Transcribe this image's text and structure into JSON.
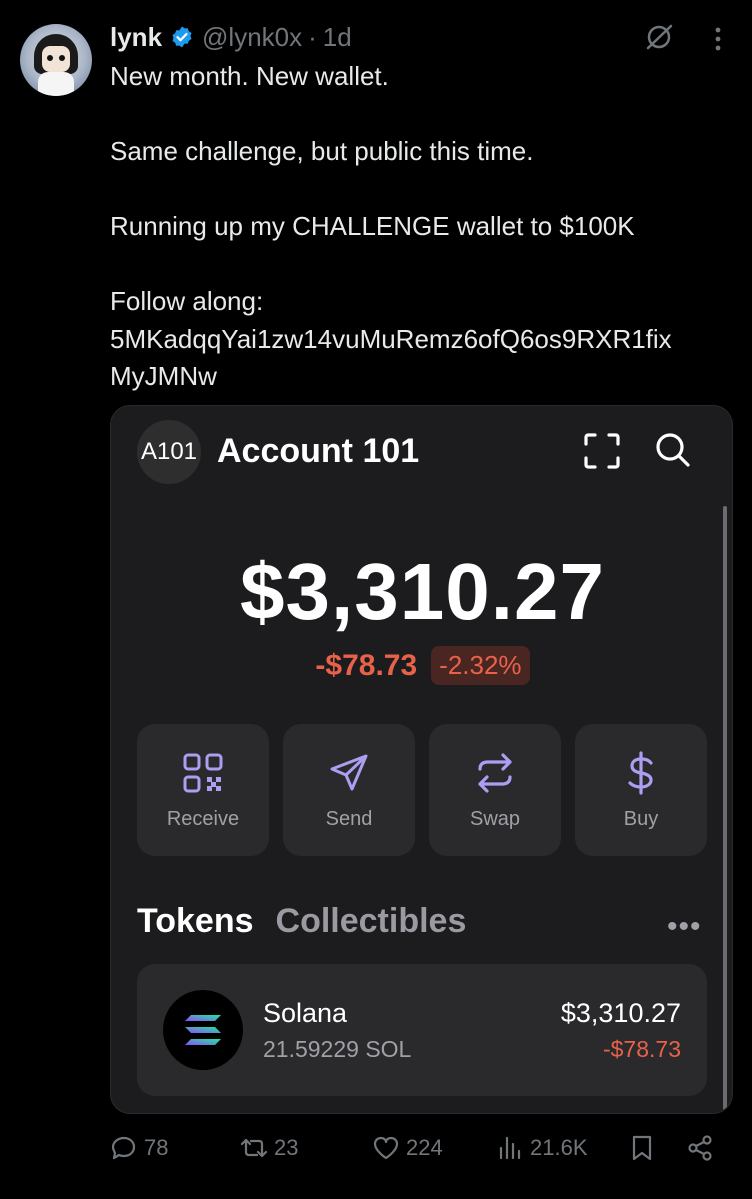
{
  "tweet": {
    "author_name": "lynk",
    "handle": "@lynk0x",
    "time": "1d",
    "text_lines": [
      "New month. New wallet.",
      "Same challenge, but public this time.",
      "Running up my CHALLENGE wallet to $100K",
      "Follow along:\n5MKadqqYai1zw14vuMuRemz6ofQ6os9RXR1fix\nMyJMNw"
    ],
    "icons": [
      "verified-badge-icon",
      "grok-icon",
      "more-icon"
    ]
  },
  "wallet": {
    "account_badge": "A101",
    "account_name": "Account 101",
    "balance": "$3,310.27",
    "change_usd": "-$78.73",
    "change_pct": "-2.32%",
    "actions": [
      {
        "label": "Receive",
        "icon": "qr-icon"
      },
      {
        "label": "Send",
        "icon": "send-icon"
      },
      {
        "label": "Swap",
        "icon": "swap-icon"
      },
      {
        "label": "Buy",
        "icon": "dollar-icon"
      }
    ],
    "tabs": {
      "active": "Tokens",
      "other": "Collectibles"
    },
    "token": {
      "name": "Solana",
      "amount": "21.59229 SOL",
      "value": "$3,310.27",
      "change": "-$78.73"
    },
    "colors": {
      "accent": "#ab9ff2",
      "negative": "#e8624a",
      "card": "#1c1c1e"
    }
  },
  "engagement": {
    "replies": "78",
    "reposts": "23",
    "likes": "224",
    "views": "21.6K"
  }
}
